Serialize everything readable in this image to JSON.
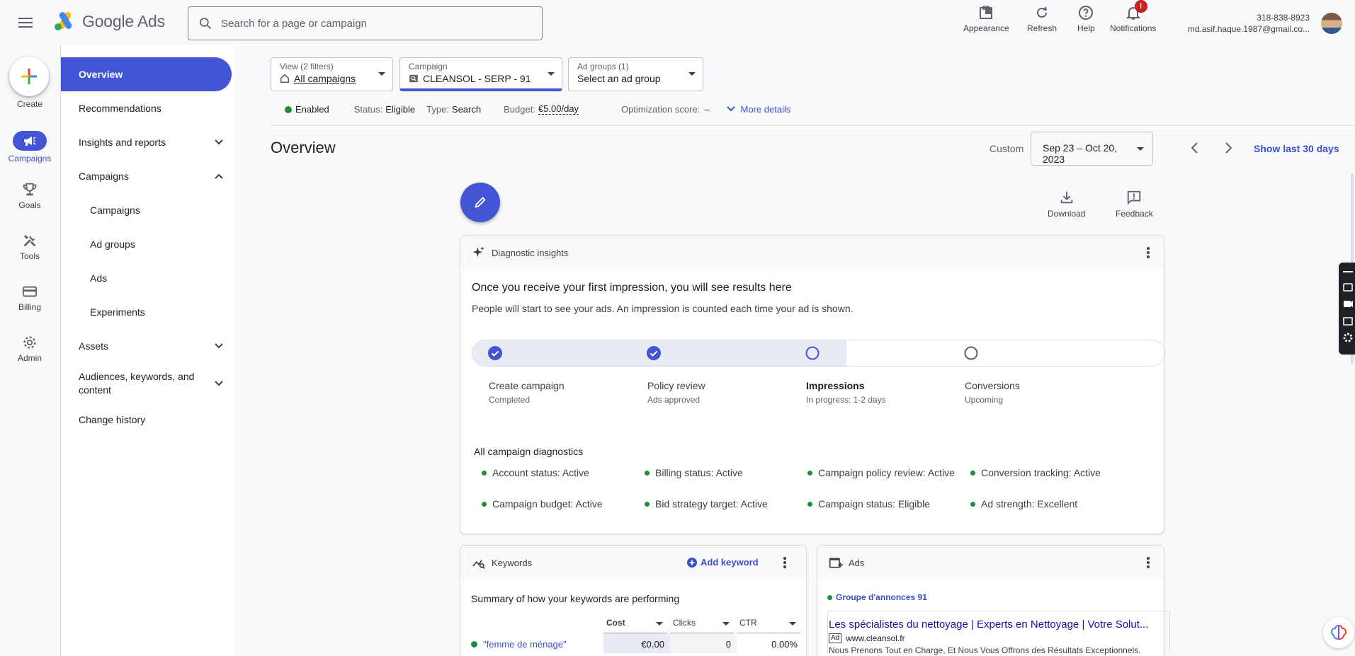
{
  "header": {
    "app_name": "Google Ads",
    "search_placeholder": "Search for a page or campaign",
    "buttons": {
      "appearance": "Appearance",
      "refresh": "Refresh",
      "help": "Help",
      "notifications": "Notifications"
    },
    "notification_badge": "!",
    "account_phone": "318-838-8923",
    "account_email": "md.asif.haque.1987@gmail.co..."
  },
  "rail": {
    "create": "Create",
    "campaigns": "Campaigns",
    "goals": "Goals",
    "tools": "Tools",
    "billing": "Billing",
    "admin": "Admin"
  },
  "nav": {
    "overview": "Overview",
    "recommendations": "Recommendations",
    "insights": "Insights and reports",
    "campaigns_group": "Campaigns",
    "campaigns": "Campaigns",
    "ad_groups": "Ad groups",
    "ads": "Ads",
    "experiments": "Experiments",
    "assets": "Assets",
    "audiences_line1": "Audiences, keywords, and",
    "audiences_line2": "content",
    "change_history": "Change history"
  },
  "selectors": {
    "view_label": "View (2 filters)",
    "view_value": "All campaigns",
    "campaign_label": "Campaign",
    "campaign_value": "CLEANSOL - SERP - 91",
    "adgroups_label": "Ad groups (1)",
    "adgroups_value": "Select an ad group"
  },
  "status": {
    "enabled": "Enabled",
    "status_label": "Status:",
    "status_value": "Eligible",
    "type_label": "Type:",
    "type_value": "Search",
    "budget_label": "Budget:",
    "budget_value": "€5.00/day",
    "opt_label": "Optimization score:",
    "opt_value": "–",
    "more_details": "More details"
  },
  "page": {
    "title": "Overview",
    "date_preset": "Custom",
    "date_range": "Sep 23 – Oct 20, 2023",
    "show_last": "Show last 30 days",
    "download": "Download",
    "feedback": "Feedback"
  },
  "diagnostics": {
    "header": "Diagnostic insights",
    "title": "Once you receive your first impression, you will see results here",
    "description": "People will start to see your ads. An impression is counted each time your ad is shown.",
    "steps": [
      {
        "label": "Create campaign",
        "sub": "Completed",
        "state": "done"
      },
      {
        "label": "Policy review",
        "sub": "Ads approved",
        "state": "done"
      },
      {
        "label": "Impressions",
        "sub": "In progress: 1-2 days",
        "state": "current"
      },
      {
        "label": "Conversions",
        "sub": "Upcoming",
        "state": "upcoming"
      }
    ],
    "progress_fraction": 0.54,
    "all_title": "All campaign diagnostics",
    "items": [
      "Account status: Active",
      "Billing status: Active",
      "Campaign policy review: Active",
      "Conversion tracking: Active",
      "Campaign budget: Active",
      "Bid strategy target: Active",
      "Campaign status: Eligible",
      "Ad strength: Excellent"
    ]
  },
  "keywords": {
    "header": "Keywords",
    "add": "Add keyword",
    "summary": "Summary of how your keywords are performing",
    "columns": [
      "Cost",
      "Clicks",
      "CTR"
    ],
    "rows": [
      {
        "keyword": "\"femme de ménage\"",
        "cost": "€0.00",
        "clicks": "0",
        "ctr": "0.00%"
      }
    ]
  },
  "ads": {
    "header": "Ads",
    "group": "Groupe d'annonces 91",
    "ad_title": "Les spécialistes du nettoyage | Experts en Nettoyage | Votre Solut...",
    "ad_badge": "Ad",
    "ad_url": "www.cleansol.fr",
    "ad_desc": "Nous Prenons Tout en Charge, Et Nous Vous Offrons des Résultats Exceptionnels."
  },
  "colors": {
    "accent": "#4355d4",
    "link": "#3c4fc5",
    "success": "#1e8e3e",
    "alert": "#c5221f"
  }
}
